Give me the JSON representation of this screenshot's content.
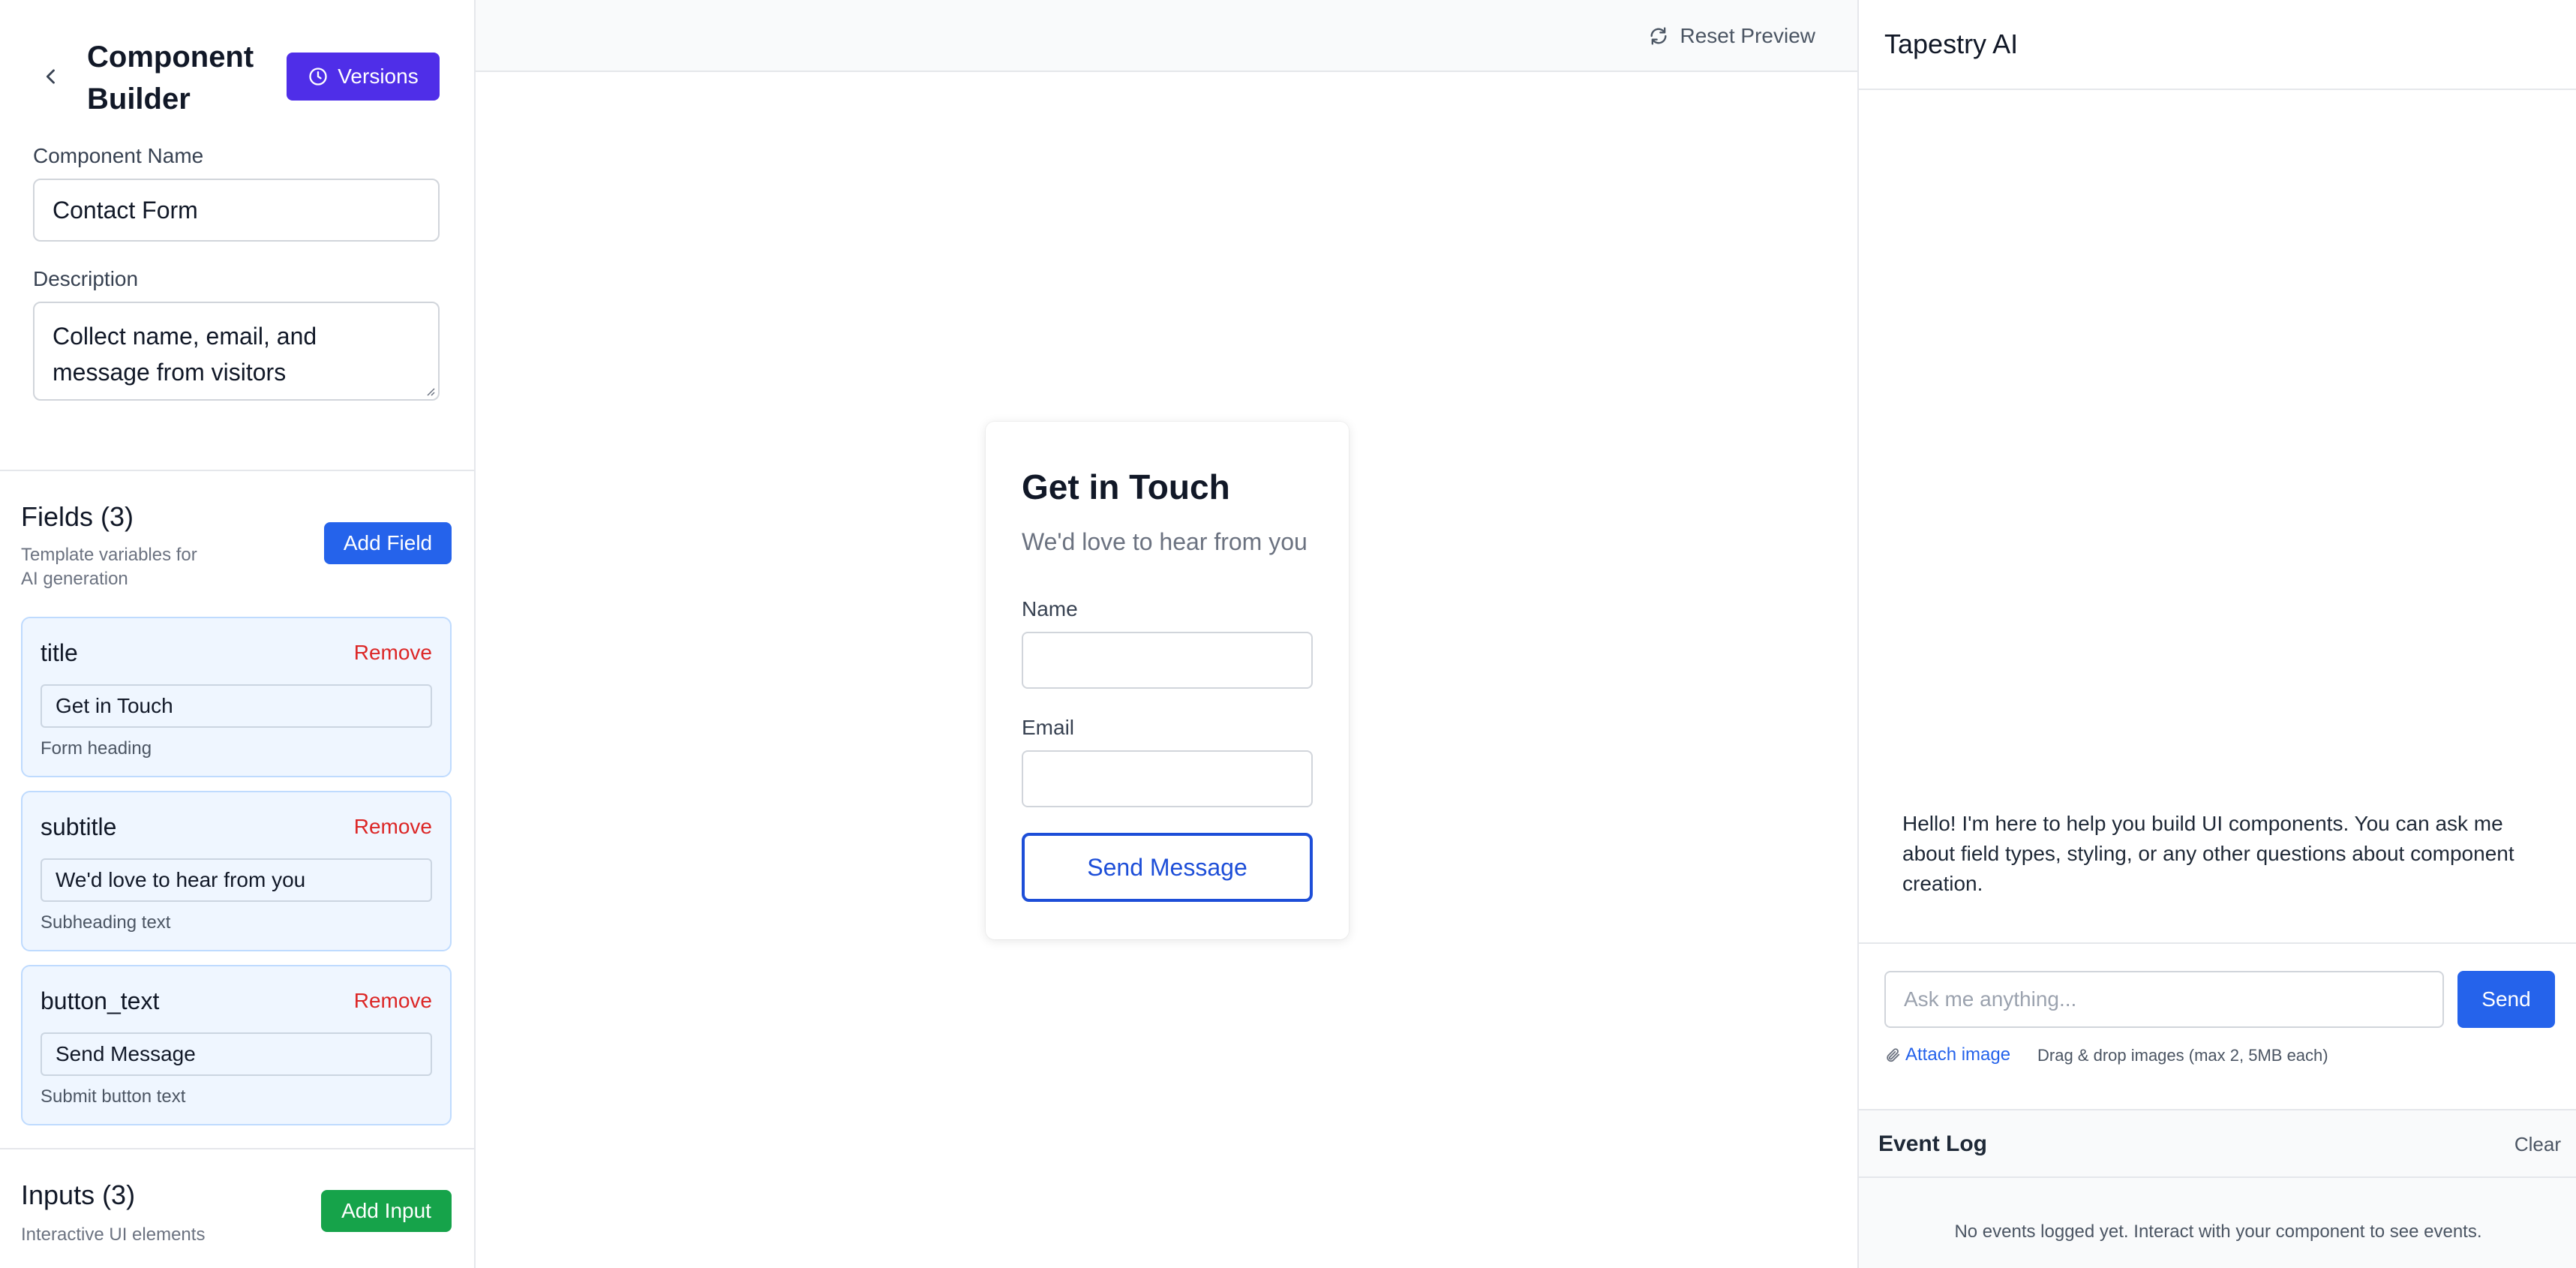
{
  "builder": {
    "title": "Component Builder",
    "versions_label": "Versions",
    "name_label": "Component Name",
    "name_value": "Contact Form",
    "description_label": "Description",
    "description_value": "Collect name, email, and message from visitors"
  },
  "fields_section": {
    "title": "Fields (3)",
    "subtitle_line1": "Template variables for",
    "subtitle_line2": "AI generation",
    "add_label": "Add Field",
    "remove_label": "Remove",
    "items": [
      {
        "key": "title",
        "value": "Get in Touch",
        "description": "Form heading"
      },
      {
        "key": "subtitle",
        "value": "We'd love to hear from you",
        "description": "Subheading text"
      },
      {
        "key": "button_text",
        "value": "Send Message",
        "description": "Submit button text"
      }
    ]
  },
  "inputs_section": {
    "title": "Inputs (3)",
    "subtitle": "Interactive UI elements",
    "add_label": "Add Input"
  },
  "preview": {
    "reset_label": "Reset Preview",
    "card_title": "Get in Touch",
    "card_subtitle": "We'd love to hear from you",
    "name_label": "Name",
    "email_label": "Email",
    "button_label": "Send Message"
  },
  "assistant": {
    "title": "Tapestry AI",
    "greeting": "Hello! I'm here to help you build UI components. You can ask me about field types, styling, or any other questions about component creation.",
    "input_placeholder": "Ask me anything...",
    "send_label": "Send",
    "attach_label": "Attach image",
    "attach_hint": "Drag & drop images (max 2, 5MB each)"
  },
  "event_log": {
    "title": "Event Log",
    "clear_label": "Clear",
    "empty_message": "No events logged yet. Interact with your component to see events."
  },
  "colors": {
    "versions_button": "#4f2ee8",
    "primary_blue": "#2563eb",
    "add_input_green": "#16a34a",
    "remove_red": "#dc2626",
    "field_card_bg": "#eff6ff"
  },
  "icons": [
    "chevron-left-icon",
    "clock-icon",
    "refresh-icon",
    "paperclip-icon",
    "resize-grip-icon"
  ]
}
